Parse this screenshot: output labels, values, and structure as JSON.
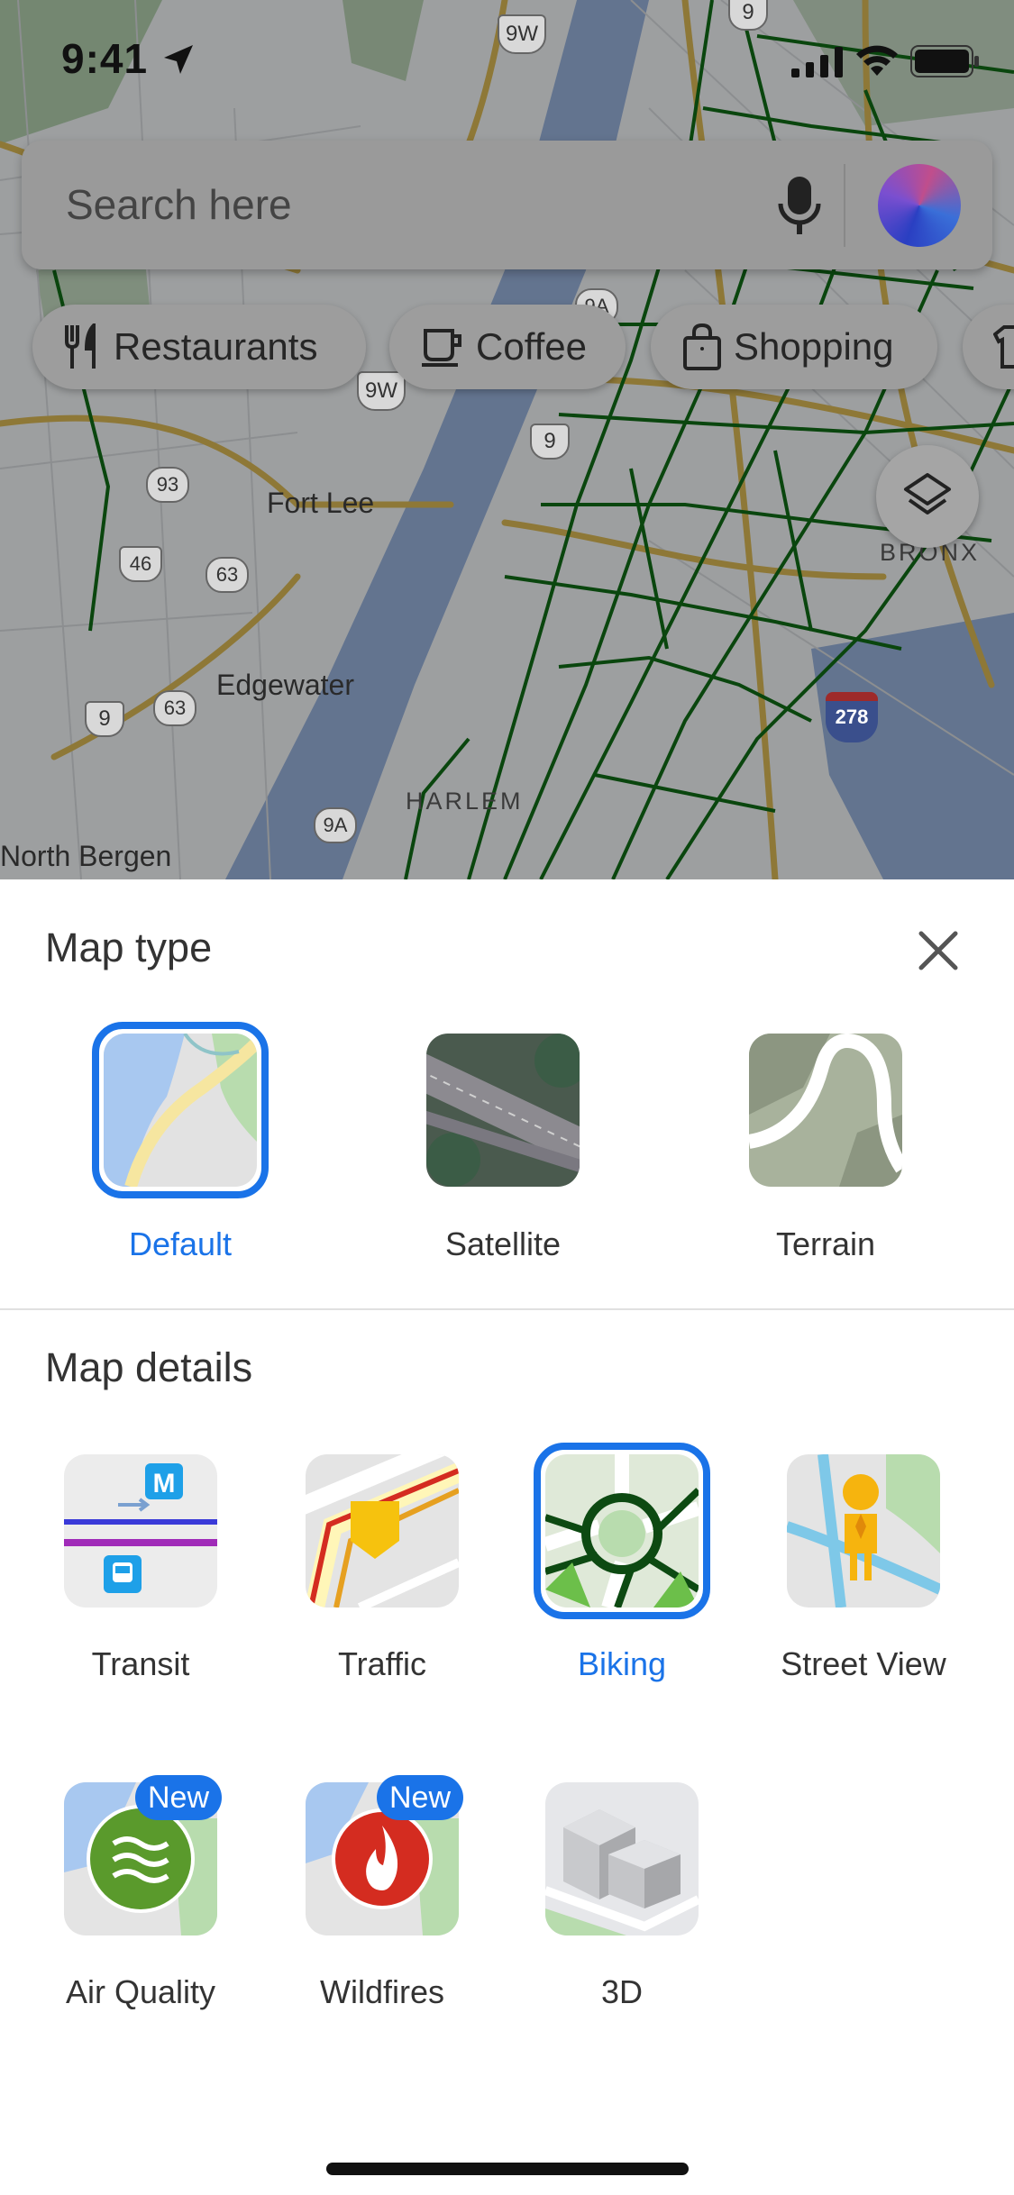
{
  "status_bar": {
    "time": "9:41"
  },
  "search": {
    "placeholder": "Search here"
  },
  "chips": [
    {
      "label": "Restaurants",
      "icon": "fork-knife-icon"
    },
    {
      "label": "Coffee",
      "icon": "coffee-cup-icon"
    },
    {
      "label": "Shopping",
      "icon": "shopping-bag-icon"
    }
  ],
  "map_labels": {
    "fort_lee": "Fort Lee",
    "edgewater": "Edgewater",
    "north_bergen": "North Bergen",
    "harlem": "HARLEM",
    "bronx": "BRONX",
    "route_9w_top": "9W",
    "route_9w_mid": "9W",
    "route_9_top": "9",
    "route_9_mid": "9",
    "route_9_left": "9",
    "route_93": "93",
    "route_46": "46",
    "route_63_a": "63",
    "route_63_b": "63",
    "route_9a_top": "9A",
    "route_9a_bottom": "9A",
    "route_278": "278"
  },
  "map_type": {
    "heading": "Map type",
    "options": [
      {
        "label": "Default",
        "selected": true
      },
      {
        "label": "Satellite",
        "selected": false
      },
      {
        "label": "Terrain",
        "selected": false
      }
    ]
  },
  "map_details": {
    "heading": "Map details",
    "items": [
      {
        "label": "Transit",
        "selected": false,
        "badge": ""
      },
      {
        "label": "Traffic",
        "selected": false,
        "badge": ""
      },
      {
        "label": "Biking",
        "selected": true,
        "badge": ""
      },
      {
        "label": "Street View",
        "selected": false,
        "badge": ""
      },
      {
        "label": "Air Quality",
        "selected": false,
        "badge": "New"
      },
      {
        "label": "Wildfires",
        "selected": false,
        "badge": "New"
      },
      {
        "label": "3D",
        "selected": false,
        "badge": ""
      }
    ]
  },
  "colors": {
    "accent": "#1a73e8",
    "bike_lane": "#0d5a12",
    "water": "#7f95b8"
  }
}
